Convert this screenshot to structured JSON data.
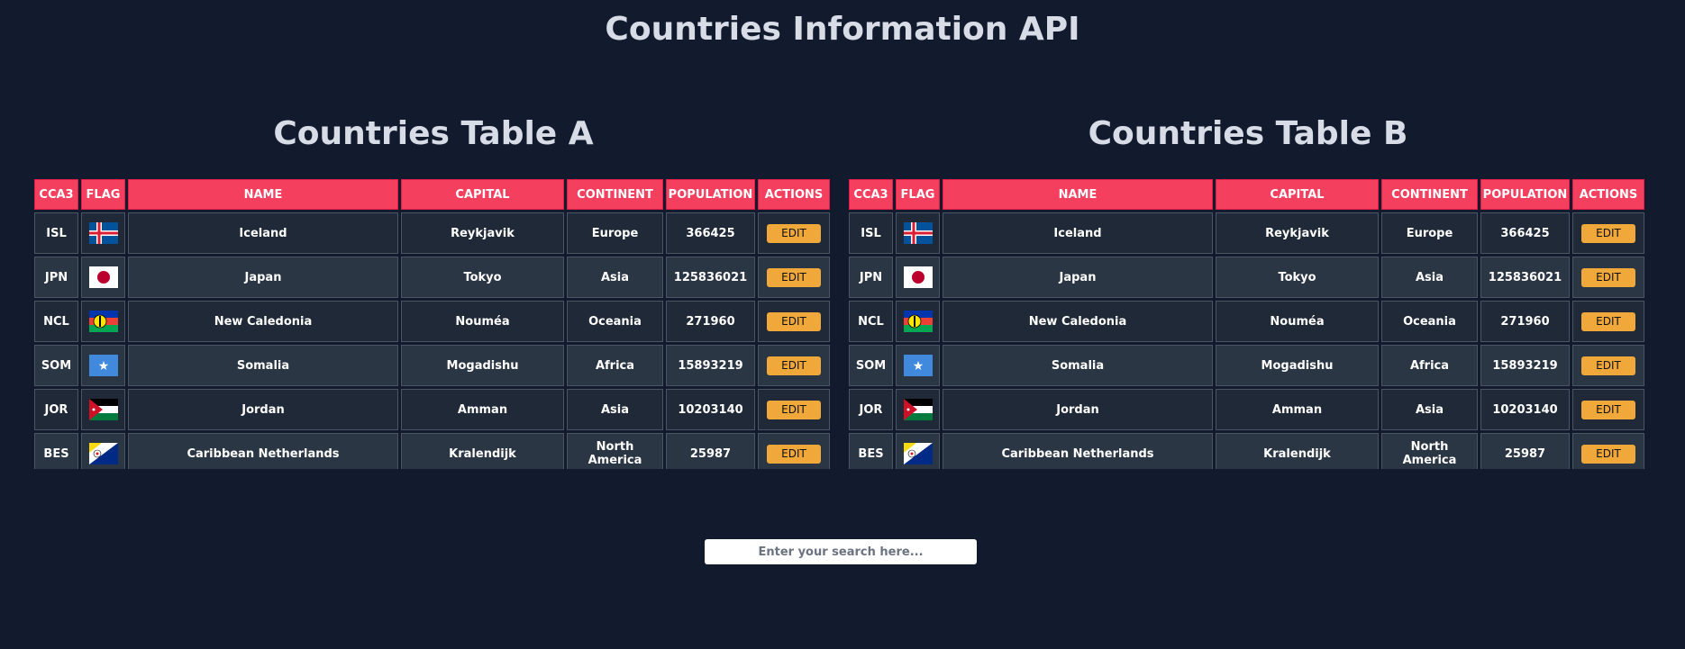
{
  "page": {
    "title": "Countries Information API"
  },
  "columns": [
    "CCA3",
    "FLAG",
    "NAME",
    "CAPITAL",
    "CONTINENT",
    "POPULATION",
    "ACTIONS"
  ],
  "tables": [
    {
      "title": "Countries Table A",
      "rows": [
        {
          "cca3": "ISL",
          "flag": "iceland-flag-icon",
          "name": "Iceland",
          "capital": "Reykjavik",
          "continent": "Europe",
          "population": "366425",
          "action": "EDIT"
        },
        {
          "cca3": "JPN",
          "flag": "japan-flag-icon",
          "name": "Japan",
          "capital": "Tokyo",
          "continent": "Asia",
          "population": "125836021",
          "action": "EDIT"
        },
        {
          "cca3": "NCL",
          "flag": "new-caledonia-flag-icon",
          "name": "New Caledonia",
          "capital": "Nouméa",
          "continent": "Oceania",
          "population": "271960",
          "action": "EDIT"
        },
        {
          "cca3": "SOM",
          "flag": "somalia-flag-icon",
          "name": "Somalia",
          "capital": "Mogadishu",
          "continent": "Africa",
          "population": "15893219",
          "action": "EDIT"
        },
        {
          "cca3": "JOR",
          "flag": "jordan-flag-icon",
          "name": "Jordan",
          "capital": "Amman",
          "continent": "Asia",
          "population": "10203140",
          "action": "EDIT"
        },
        {
          "cca3": "BES",
          "flag": "caribbean-netherlands-flag-icon",
          "name": "Caribbean Netherlands",
          "capital": "Kralendijk",
          "continent": "North America",
          "population": "25987",
          "action": "EDIT"
        }
      ]
    },
    {
      "title": "Countries Table B",
      "rows": [
        {
          "cca3": "ISL",
          "flag": "iceland-flag-icon",
          "name": "Iceland",
          "capital": "Reykjavik",
          "continent": "Europe",
          "population": "366425",
          "action": "EDIT"
        },
        {
          "cca3": "JPN",
          "flag": "japan-flag-icon",
          "name": "Japan",
          "capital": "Tokyo",
          "continent": "Asia",
          "population": "125836021",
          "action": "EDIT"
        },
        {
          "cca3": "NCL",
          "flag": "new-caledonia-flag-icon",
          "name": "New Caledonia",
          "capital": "Nouméa",
          "continent": "Oceania",
          "population": "271960",
          "action": "EDIT"
        },
        {
          "cca3": "SOM",
          "flag": "somalia-flag-icon",
          "name": "Somalia",
          "capital": "Mogadishu",
          "continent": "Africa",
          "population": "15893219",
          "action": "EDIT"
        },
        {
          "cca3": "JOR",
          "flag": "jordan-flag-icon",
          "name": "Jordan",
          "capital": "Amman",
          "continent": "Asia",
          "population": "10203140",
          "action": "EDIT"
        },
        {
          "cca3": "BES",
          "flag": "caribbean-netherlands-flag-icon",
          "name": "Caribbean Netherlands",
          "capital": "Kralendijk",
          "continent": "North America",
          "population": "25987",
          "action": "EDIT"
        }
      ]
    }
  ],
  "search": {
    "placeholder": "Enter your search here..."
  },
  "colors": {
    "background": "#121a2e",
    "header": "#f43f5e",
    "edit_button": "#f0a83a",
    "row_dark": "#1f2937",
    "row_light": "#2b3645"
  }
}
